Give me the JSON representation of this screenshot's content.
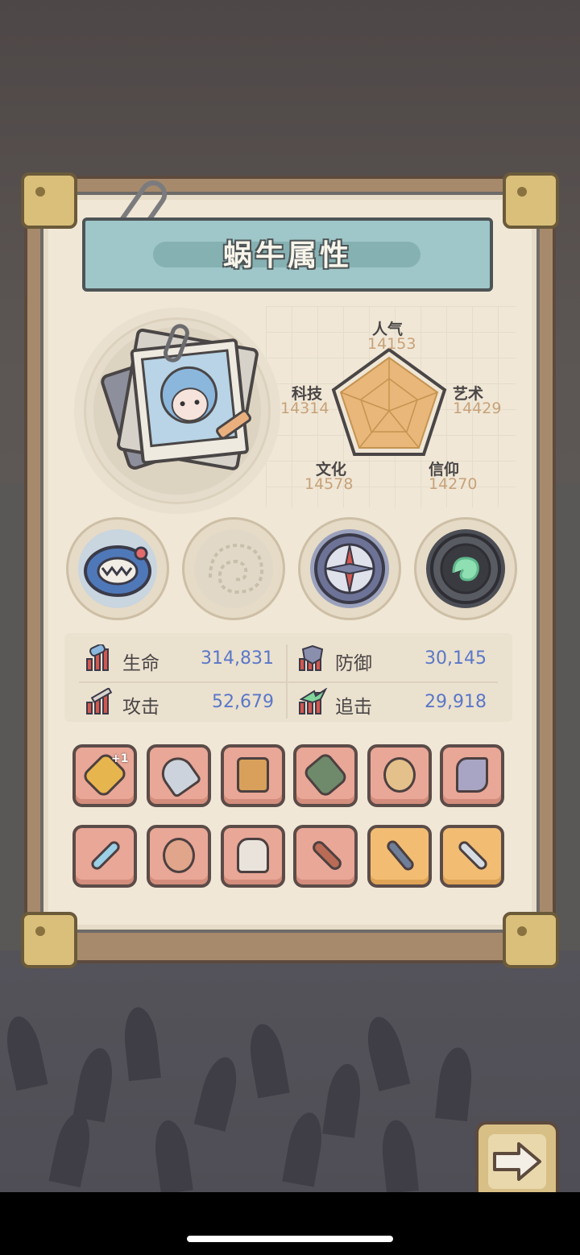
{
  "panel": {
    "title": "蜗牛属性"
  },
  "radar": {
    "stats": [
      {
        "name": "人气",
        "value": "14153"
      },
      {
        "name": "艺术",
        "value": "14429"
      },
      {
        "name": "信仰",
        "value": "14270"
      },
      {
        "name": "文化",
        "value": "14578"
      },
      {
        "name": "科技",
        "value": "14314"
      }
    ]
  },
  "stats": {
    "hp": {
      "label": "生命",
      "value": "314,831"
    },
    "defense": {
      "label": "防御",
      "value": "30,145"
    },
    "attack": {
      "label": "攻击",
      "value": "52,679"
    },
    "pursuit": {
      "label": "追击",
      "value": "29,918"
    }
  },
  "medals": [
    {
      "icon": "monster-medal-icon"
    },
    {
      "icon": "snail-shell-medal-icon"
    },
    {
      "icon": "compass-medal-icon"
    },
    {
      "icon": "green-gem-medal-icon"
    }
  ],
  "equipment": {
    "row1": [
      {
        "icon": "golden-spear-icon",
        "badge": "+1"
      },
      {
        "icon": "firework-rocket-icon"
      },
      {
        "icon": "crossbow-icon"
      },
      {
        "icon": "war-hammer-icon"
      },
      {
        "icon": "skull-scepter-icon"
      },
      {
        "icon": "crystal-gauntlet-icon"
      }
    ],
    "row2": [
      {
        "icon": "blue-sword-icon"
      },
      {
        "icon": "gem-ring-icon"
      },
      {
        "icon": "armor-vest-icon"
      },
      {
        "icon": "dragon-blade-icon"
      },
      {
        "icon": "trident-staff-icon"
      },
      {
        "icon": "dagger-icon"
      }
    ]
  },
  "colors": {
    "slot_normal": "#e9a797",
    "slot_gold": "#f2bd73",
    "title_banner": "#9fc6c8",
    "stat_value": "#5a78c8",
    "radar_value": "#c7a27a"
  }
}
